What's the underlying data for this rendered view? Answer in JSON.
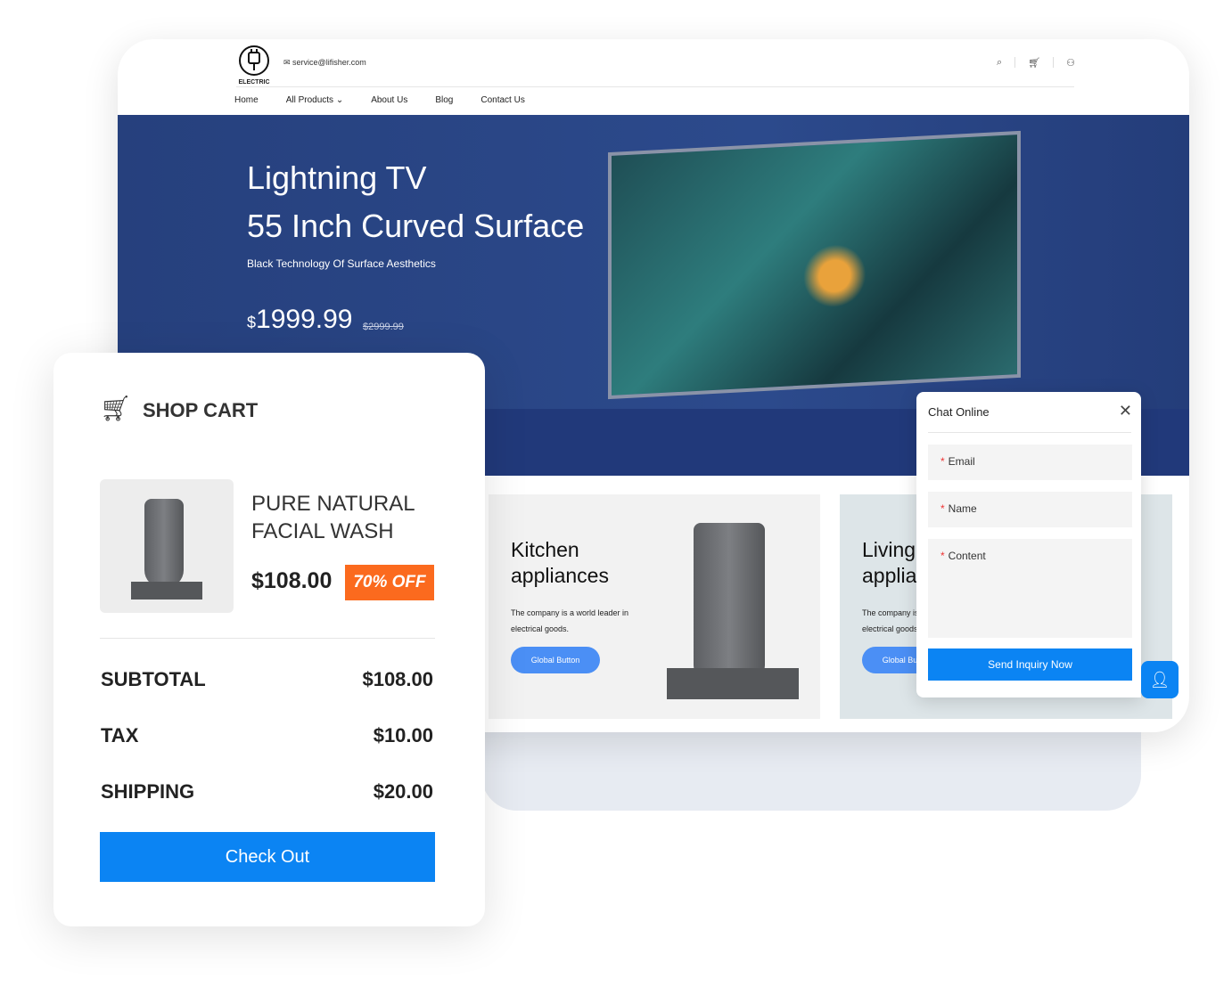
{
  "header": {
    "logo_text": "ELECTRIC",
    "email": "service@lifisher.com",
    "icons": [
      "search-icon",
      "cart-icon",
      "user-icon"
    ]
  },
  "nav": [
    "Home",
    "All Products ⌄",
    "About Us",
    "Blog",
    "Contact Us"
  ],
  "hero": {
    "title1": "Lightning TV",
    "title2": "55 Inch Curved Surface",
    "subtitle": "Black Technology Of Surface Aesthetics",
    "currency": "$",
    "price": "1999.99",
    "old_price": "$2999.99"
  },
  "cards": [
    {
      "title1": "Kitchen",
      "title2": "appliances",
      "text": "The company is a world leader in electrical goods.",
      "button": "Global Button"
    },
    {
      "title1": "Living",
      "title2": "appliances",
      "text": "The company is a world leader in electrical goods.",
      "button": "Global Button"
    }
  ],
  "cart": {
    "title": "SHOP CART",
    "product": "PURE NATURAL FACIAL WASH",
    "price": "$108.00",
    "discount": "70% OFF",
    "subtotal_label": "SUBTOTAL",
    "subtotal": "$108.00",
    "tax_label": "TAX",
    "tax": "$10.00",
    "shipping_label": "SHIPPING",
    "shipping": "$20.00",
    "checkout": "Check Out"
  },
  "chat": {
    "title": "Chat Online",
    "email": "Email",
    "name": "Name",
    "content": "Content",
    "required": "*",
    "send": "Send Inquiry Now"
  },
  "colors": {
    "primary": "#0b84f3",
    "hero": "#2a4584",
    "badge": "#fb6a1e"
  }
}
